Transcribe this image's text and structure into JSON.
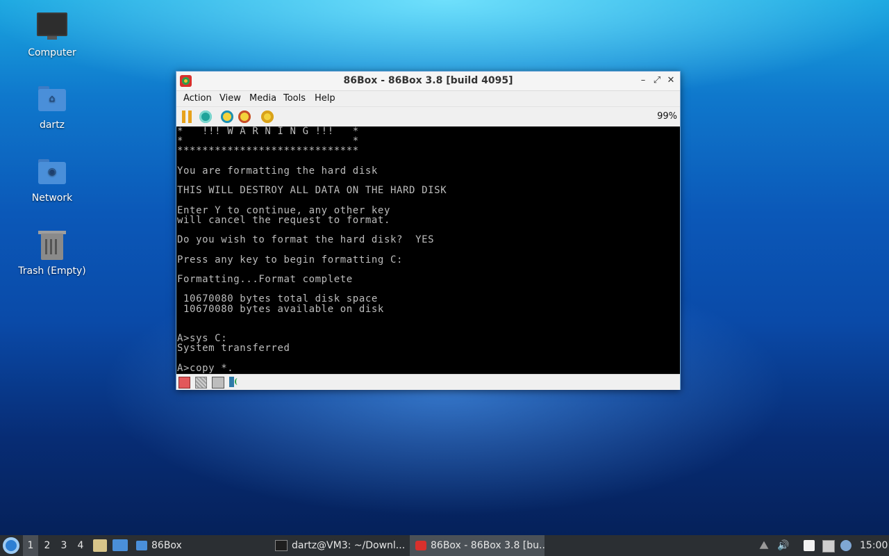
{
  "desktop": {
    "icons": [
      {
        "label": "Computer"
      },
      {
        "label": "dartz"
      },
      {
        "label": "Network"
      },
      {
        "label": "Trash (Empty)"
      }
    ]
  },
  "window": {
    "title": "86Box - 86Box 3.8 [build 4095]",
    "controls": {
      "minimize": "–",
      "maximize": "⤢",
      "close": "✕"
    },
    "menu": [
      "Action",
      "View",
      "Media",
      "Tools",
      "Help"
    ],
    "speed": "99%",
    "console_lines": [
      "*   !!! W A R N I N G !!!   *",
      "*                           *",
      "*****************************",
      "",
      "You are formatting the hard disk",
      "",
      "THIS WILL DESTROY ALL DATA ON THE HARD DISK",
      "",
      "Enter Y to continue, any other key",
      "will cancel the request to format.",
      "",
      "Do you wish to format the hard disk?  YES",
      "",
      "Press any key to begin formatting C:",
      "",
      "Formatting...Format complete",
      "",
      " 10670080 bytes total disk space",
      " 10670080 bytes available on disk",
      "",
      "",
      "A>sys C:",
      "System transferred",
      "",
      "A>copy *."
    ]
  },
  "taskbar": {
    "workspaces": [
      "1",
      "2",
      "3",
      "4"
    ],
    "folder_launcher": "86Box",
    "tasks": [
      {
        "label": "dartz@VM3: ~/Downl...",
        "active": false
      },
      {
        "label": "86Box - 86Box 3.8 [bu...",
        "active": true
      }
    ],
    "clock": "15:00"
  }
}
